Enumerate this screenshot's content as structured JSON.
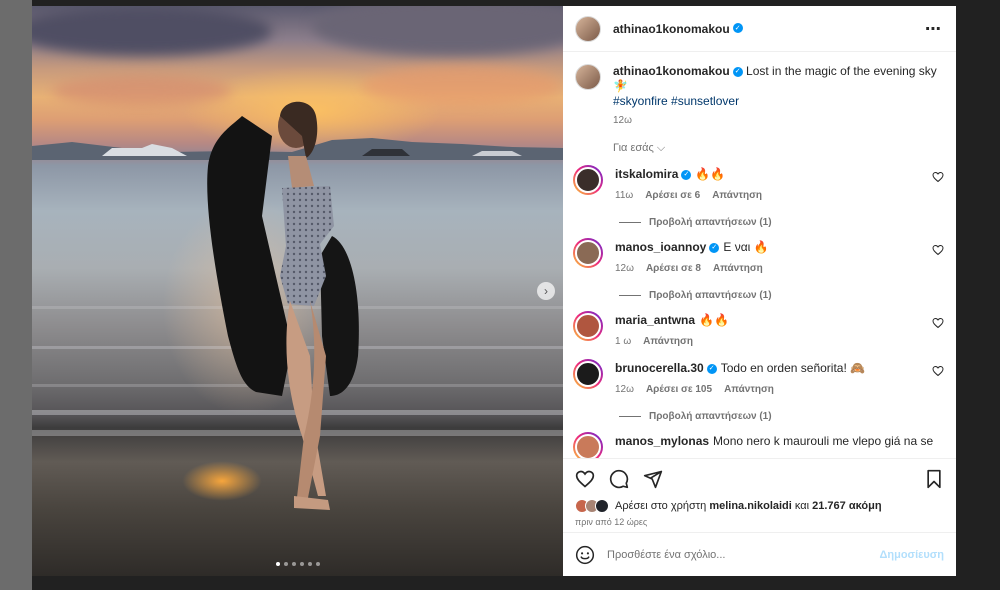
{
  "post": {
    "author": {
      "username": "athinao1konomakou",
      "verified": true
    },
    "caption": {
      "text": "Lost in the magic of the evening sky 🧚",
      "hashtags": "#skyonfire #sunsetlover",
      "age": "12ω"
    },
    "for_you_label": "Για εσάς",
    "comments": [
      {
        "username": "itskalomira",
        "verified": true,
        "text": "🔥🔥",
        "age": "11ω",
        "likes": "Αρέσει σε 6",
        "reply": "Απάντηση",
        "view_replies": "Προβολή απαντήσεων (1)",
        "avatar_color": "#3a2e2a"
      },
      {
        "username": "manos_ioannoy",
        "verified": true,
        "text": "Ε ναι 🔥",
        "age": "12ω",
        "likes": "Αρέσει σε 8",
        "reply": "Απάντηση",
        "view_replies": "Προβολή απαντήσεων (1)",
        "avatar_color": "#8a6a55"
      },
      {
        "username": "maria_antwna",
        "verified": false,
        "text": "🔥🔥",
        "age": "1 ω",
        "likes": "",
        "reply": "Απάντηση",
        "view_replies": "",
        "avatar_color": "#b0563f"
      },
      {
        "username": "brunocerella.30",
        "verified": true,
        "text": "Todo en orden señorita! 🙈",
        "age": "12ω",
        "likes": "Αρέσει σε 105",
        "reply": "Απάντηση",
        "view_replies": "Προβολή απαντήσεων (1)",
        "avatar_color": "#1b1b1b"
      },
      {
        "username": "manos_mylonas",
        "verified": false,
        "text": "Mono nero k maurouli me vlepo giá na se",
        "age": "",
        "likes": "",
        "reply": "",
        "view_replies": "",
        "avatar_color": "#c97a5a"
      }
    ],
    "liked_by": {
      "prefix": "Αρέσει στο χρήστη",
      "user": "melina.nikolaidi",
      "joiner": "και",
      "others": "21.767 ακόμη"
    },
    "time_ago": "πριν από 12 ώρες",
    "add_comment": {
      "placeholder": "Προσθέστε ένα σχόλιο...",
      "post_label": "Δημοσίευση"
    },
    "carousel": {
      "count": 6,
      "active_index": 0
    }
  },
  "icons": {
    "more": "more-options-icon",
    "like": "heart-icon",
    "comment": "comment-icon",
    "share": "share-icon",
    "save": "bookmark-icon",
    "emoji": "emoji-icon",
    "next": "chevron-right-icon"
  },
  "colors": {
    "verified": "#0095f6",
    "link": "#00376b",
    "muted": "#737373",
    "post_button_disabled": "#b2dffc"
  }
}
